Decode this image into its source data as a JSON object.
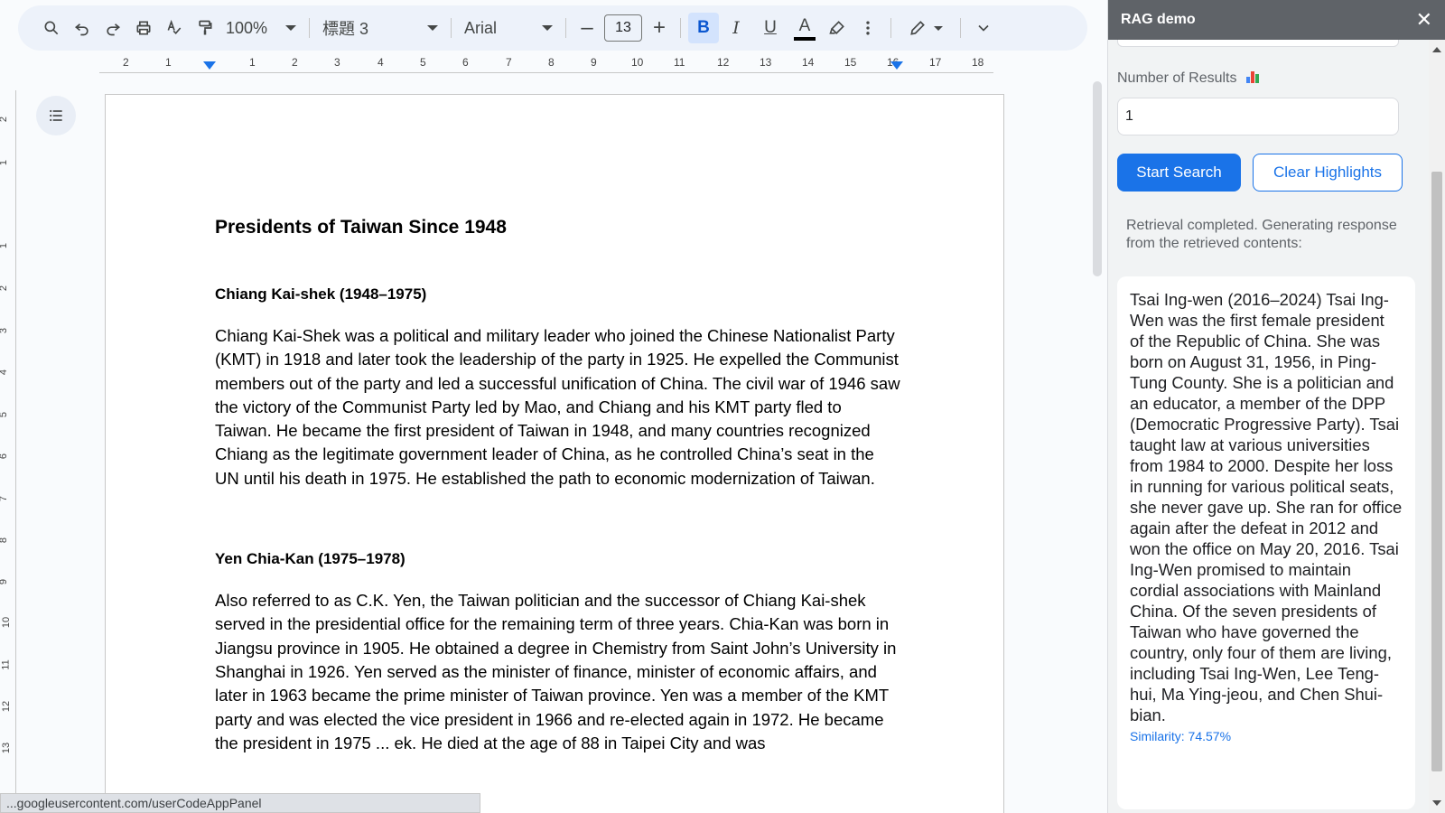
{
  "toolbar": {
    "zoom": "100%",
    "paragraph_style": "標題 3",
    "font": "Arial",
    "font_size": "13",
    "minus": "–",
    "plus": "+",
    "bold": "B",
    "italic": "I",
    "underline": "U",
    "text_color": "A"
  },
  "ruler": {
    "ticks": [
      "2",
      "1",
      "1",
      "2",
      "3",
      "4",
      "5",
      "6",
      "7",
      "8",
      "9",
      "10",
      "11",
      "12",
      "13",
      "14",
      "15",
      "16",
      "17",
      "18"
    ]
  },
  "vruler": {
    "ticks": [
      "2",
      "1",
      "1",
      "2",
      "3",
      "4",
      "5",
      "6",
      "7",
      "8",
      "9",
      "10",
      "11",
      "12",
      "13"
    ]
  },
  "document": {
    "title": "Presidents of Taiwan Since 1948",
    "sections": [
      {
        "heading": "Chiang Kai-shek (1948–1975)",
        "body": "Chiang Kai-Shek was a political and military leader who joined the Chinese Nationalist Party (KMT) in 1918 and later took the leadership of the party in 1925. He expelled the Communist members out of the party and led a successful unification of China. The civil war of 1946 saw the victory of the Communist Party led by Mao, and Chiang and his KMT party fled to Taiwan. He became the first president of Taiwan in 1948, and many countries recognized Chiang as the legitimate government leader of China, as he controlled China’s seat in the UN until his death in 1975. He established the path to economic modernization of Taiwan."
      },
      {
        "heading": "Yen Chia-Kan (1975–1978)",
        "body": "Also referred to as C.K. Yen, the Taiwan politician and the successor of Chiang Kai-shek served in the presidential office for the remaining term of three years. Chia-Kan was born in Jiangsu province in 1905. He obtained a degree in Chemistry from Saint John’s University in Shanghai in 1926. Yen served as the minister of finance, minister of economic affairs, and later in 1963 became the prime minister of Taiwan province. Yen was a member of the KMT party and was elected the vice president in 1966 and re-elected again in 1972. He became the president in 1975 ... ek. He died at the age of 88 in Taipei City and was"
      }
    ]
  },
  "status_url": "...googleusercontent.com/userCodeAppPanel",
  "sidebar": {
    "title": "RAG demo",
    "close": "✕",
    "results_label": "Number of Results",
    "results_value": "1",
    "start_button": "Start Search",
    "clear_button": "Clear Highlights",
    "status": "Retrieval completed. Generating response from the retrieved contents:",
    "result_text": "Tsai Ing-wen (2016–2024) Tsai Ing-Wen was the first female president of the Republic of China. She was born on August 31, 1956, in Ping-Tung County. She is a politician and an educator, a member of the DPP (Democratic Progressive Party). Tsai taught law at various universities from 1984 to 2000. Despite her loss in running for various political seats, she never gave up. She ran for office again after the defeat in 2012 and won the office on May 20, 2016. Tsai Ing-Wen promised to maintain cordial associations with Mainland China. Of the seven presidents of Taiwan who have governed the country, only four of them are living, including Tsai Ing-Wen, Lee Teng-hui, Ma Ying-jeou, and Chen Shui-bian.",
    "similarity": "Similarity: 74.57%"
  },
  "colors": {
    "accent": "#1a73e8",
    "header": "#5f6368",
    "bold_active": "#d3e3fd"
  },
  "icons": [
    "search-icon",
    "undo-icon",
    "redo-icon",
    "print-icon",
    "spellcheck-icon",
    "paint-format-icon",
    "highlighter-icon",
    "more-vert-icon",
    "pen-icon",
    "chevron-down-icon",
    "outline-list-icon",
    "close-icon",
    "bar-chart-icon"
  ]
}
